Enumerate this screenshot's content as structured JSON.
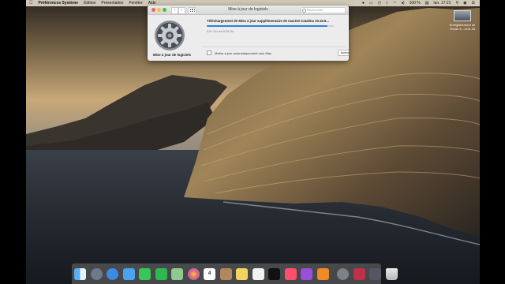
{
  "menubar": {
    "app_name": "Préférences Système",
    "menus": [
      "Édition",
      "Présentation",
      "Fenêtre",
      "Aide"
    ],
    "battery": "100 %",
    "clock": "lun. 17:21"
  },
  "desktop_file": {
    "label_line1": "Enregistrement de",
    "label_line2": "l'écran 2...1114.33"
  },
  "window": {
    "title": "Mise à jour de logiciels",
    "search_placeholder": "Rechercher",
    "pane_label": "Mise à jour de logiciels",
    "download_title": "Téléchargement de Mise à jour supplémentaire de macOS Catalina 10.15.6...",
    "download_size": "5,01 Go sur 5,25 Go",
    "progress_fraction": 0.95,
    "auto_update_label": "Mettre à jour automatiquement mon Mac",
    "advanced_label": "Avancé...",
    "help_label": "?"
  },
  "dock": {
    "icons": [
      "finder-icon",
      "launchpad-icon",
      "safari-icon",
      "mail-icon",
      "messages-icon",
      "facetime-icon",
      "maps-icon",
      "photos-icon",
      "calendar-icon",
      "contacts-icon",
      "notes-icon",
      "reminders-icon",
      "appletv-icon",
      "music-icon",
      "podcasts-icon",
      "books-icon",
      "system-preferences-icon",
      "photo-booth-icon",
      "instruments-icon",
      "trash-icon"
    ],
    "calendar_day": "4"
  }
}
